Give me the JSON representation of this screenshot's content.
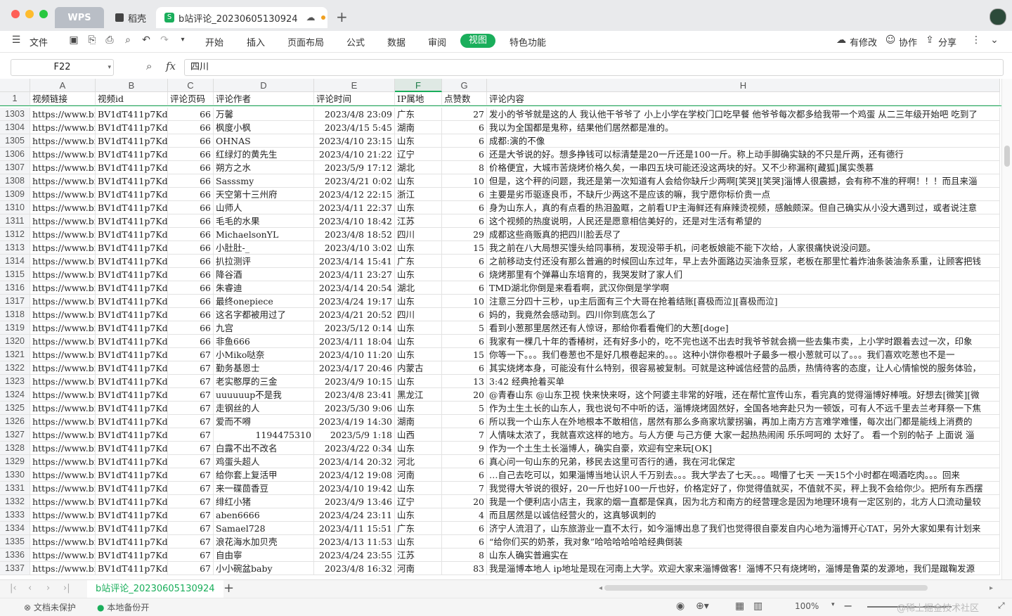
{
  "titlebar": {
    "tabs": [
      {
        "label": "WPS"
      },
      {
        "label": "稻壳"
      },
      {
        "label": "b站评论_20230605130924"
      }
    ],
    "new_tab": "+"
  },
  "toolbar": {
    "file_menu": "文件",
    "menu_items": [
      "开始",
      "插入",
      "页面布局",
      "公式",
      "数据",
      "审阅",
      "视图",
      "特色功能"
    ],
    "active_menu": "视图",
    "right_actions": [
      "有修改",
      "协作",
      "分享"
    ]
  },
  "formula_bar": {
    "cell_ref": "F22",
    "fx_label": "fx",
    "value": "四川"
  },
  "sheet": {
    "columns": [
      "A",
      "B",
      "C",
      "D",
      "E",
      "F",
      "G",
      "H"
    ],
    "selected_column": "F",
    "header_row_num": "1",
    "headers": [
      "视频链接",
      "视频id",
      "评论页码",
      "评论作者",
      "评论时间",
      "IP属地",
      "点赞数",
      "评论内容"
    ],
    "rows": [
      [
        "1303",
        "https://www.bili",
        "BV1dT411p7Kd",
        "66",
        "万馨",
        "2023/4/8 23:09",
        "广东",
        "27",
        "发小的爷爷就是这的人 我认他干爷爷了 小上小学在学校门口吃早餐 他爷爷每次都多给我带一个鸡蛋 从二三年级开始吧 吃到了"
      ],
      [
        "1304",
        "https://www.bili",
        "BV1dT411p7Kd",
        "66",
        "枫度小枫",
        "2023/4/15 5:45",
        "湖南",
        "6",
        "我以为全国都是鬼称，结果他们居然都是准的。"
      ],
      [
        "1305",
        "https://www.bili",
        "BV1dT411p7Kd",
        "66",
        "OHNAS",
        "2023/4/10 23:15",
        "山东",
        "6",
        "成都:演的不像"
      ],
      [
        "1306",
        "https://www.bili",
        "BV1dT411p7Kd",
        "66",
        "红绿灯的黄先生",
        "2023/4/10 21:22",
        "辽宁",
        "6",
        "还是大爷说的好。想多挣钱可以标清楚是20一斤还是100一斤。称上动手脚确实缺的不只是斤两，还有德行"
      ],
      [
        "1307",
        "https://www.bili",
        "BV1dT411p7Kd",
        "66",
        "朔方之水",
        "2023/5/9 17:12",
        "湖北",
        "8",
        "价格便宜，大城市苦烧烤价格久矣，一串四五块可能还没这两块的好。又不少称漏称[藏狐]属实羡慕"
      ],
      [
        "1308",
        "https://www.bili",
        "BV1dT411p7Kd",
        "66",
        "Sasssmy",
        "2023/4/21 0:02",
        "山东",
        "10",
        "但是，这个秤的问题，我还是第一次知道有人会给你缺斤少两啊[笑哭][笑哭]淄博人很震撼，会有称不准的秤啊！！！而且来淄"
      ],
      [
        "1309",
        "https://www.bili",
        "BV1dT411p7Kd",
        "66",
        "天空第十三州府",
        "2023/4/12 22:15",
        "浙江",
        "6",
        "主要是劣币驱逐良币，不缺斤少两这不是应该的嘛，我宁愿你标价贵一点"
      ],
      [
        "1310",
        "https://www.bili",
        "BV1dT411p7Kd",
        "66",
        "山师人",
        "2023/4/11 22:37",
        "山东",
        "6",
        "身为山东人，真的有点看的热泪盈眶，之前看UP主海鲜还有麻辣烫视频，感触颇深。但自己确实从小没大遇到过，或者说注意"
      ],
      [
        "1311",
        "https://www.bili",
        "BV1dT411p7Kd",
        "66",
        "毛毛的水果",
        "2023/4/10 18:42",
        "江苏",
        "6",
        "这个视频的热度说明，人民还是愿意相信美好的，还是对生活有希望的"
      ],
      [
        "1312",
        "https://www.bili",
        "BV1dT411p7Kd",
        "66",
        "MichaelsonYL",
        "2023/4/8 18:52",
        "四川",
        "29",
        "成都这些商贩真的把四川脸丢尽了"
      ],
      [
        "1313",
        "https://www.bili",
        "BV1dT411p7Kd",
        "66",
        "小肚肚-_",
        "2023/4/10 3:02",
        "山东",
        "15",
        "我之前在八大局想买馒头给同事稍，发现没带手机，问老板娘能不能下次给，人家很痛快说没问题。"
      ],
      [
        "1314",
        "https://www.bili",
        "BV1dT411p7Kd",
        "66",
        "扒拉测评",
        "2023/4/14 15:41",
        "广东",
        "6",
        "之前移动支付还没有那么普遍的时候回山东过年，早上去外面路边买油条豆浆，老板在那里忙着炸油条装油条系重，让顾客把钱"
      ],
      [
        "1315",
        "https://www.bili",
        "BV1dT411p7Kd",
        "66",
        "降谷酒",
        "2023/4/11 23:27",
        "山东",
        "6",
        "烧烤那里有个弹幕山东培育的，我哭发财了家人们"
      ],
      [
        "1316",
        "https://www.bili",
        "BV1dT411p7Kd",
        "66",
        "朱睿迪",
        "2023/4/14 20:54",
        "湖北",
        "6",
        "TMD湖北你倒是来看看啊，武汉你倒是学学啊"
      ],
      [
        "1317",
        "https://www.bili",
        "BV1dT411p7Kd",
        "66",
        "最终onepiece",
        "2023/4/24 19:17",
        "山东",
        "10",
        "注意三分四十三秒，up主后面有三个大哥在抢着结账[喜极而泣][喜极而泣]"
      ],
      [
        "1318",
        "https://www.bili",
        "BV1dT411p7Kd",
        "66",
        "这名字都被用过了",
        "2023/4/21 20:52",
        "四川",
        "6",
        "妈的，我竟然会感动到。四川你到底怎么了"
      ],
      [
        "1319",
        "https://www.bili",
        "BV1dT411p7Kd",
        "66",
        "九宫",
        "2023/5/12 0:14",
        "山东",
        "5",
        "看到小葱那里居然还有人惊讶，那给你看看俺们的大葱[doge]"
      ],
      [
        "1320",
        "https://www.bili",
        "BV1dT411p7Kd",
        "66",
        "非鱼666",
        "2023/4/11 18:04",
        "山东",
        "6",
        "我家有一棵几十年的香椿树，还有好多小的，吃不完也送不出去时我爷爷就会摘一些去集市卖，上小学时跟着去过一次，印象"
      ],
      [
        "1321",
        "https://www.bili",
        "BV1dT411p7Kd",
        "67",
        "小Miko哒奈",
        "2023/4/10 11:20",
        "山东",
        "15",
        "你等一下。。。我们卷葱也不是好几根卷起来的。。。这种小饼你卷根叶子最多一根小葱就可以了。。。我们喜欢吃葱也不是一"
      ],
      [
        "1322",
        "https://www.bili",
        "BV1dT411p7Kd",
        "67",
        "勤务基恩士",
        "2023/4/17 20:46",
        "内蒙古",
        "6",
        "其实烧烤本身，可能没有什么特别，很容易被复制。可就是这种诚信经营的品质，热情待客的态度，让人心情愉悦的服务体验，"
      ],
      [
        "1323",
        "https://www.bili",
        "BV1dT411p7Kd",
        "67",
        "老实憨厚的三金",
        "2023/4/9 10:15",
        "山东",
        "13",
        "3:42 经典抢着买单"
      ],
      [
        "1324",
        "https://www.bili",
        "BV1dT411p7Kd",
        "67",
        "uuuuuup不是我",
        "2023/4/8 23:41",
        "黑龙江",
        "20",
        "@青春山东 @山东卫视 快来快来呀，这个阿婆主非常的好哦，还在帮忙宣传山东，看完真的觉得淄博好棒哦。好想去[微笑][微"
      ],
      [
        "1325",
        "https://www.bili",
        "BV1dT411p7Kd",
        "67",
        "走钢丝的人",
        "2023/5/30 9:06",
        "山东",
        "5",
        "作为土生土长的山东人，我也说句不中听的话，淄博烧烤固然好，全国各地奔赴只为一顿饭，可有人不远千里去兰考拜祭一下焦"
      ],
      [
        "1326",
        "https://www.bili",
        "BV1dT411p7Kd",
        "67",
        "爱而不嘚",
        "2023/4/19 14:30",
        "湖南",
        "6",
        "所以我一个山东人在外地根本不敢相信，居然有那么多商家坑蒙拐骗，再加上南方方言难学难懂，每次出门都是能线上消费的"
      ],
      [
        "1327",
        "https://www.bili",
        "BV1dT411p7Kd",
        "67",
        "1194475310",
        "2023/5/9 1:18",
        "山西",
        "7",
        "人情味太浓了，我就喜欢这样的地方。与人方便 与己方便 大家一起热热闹闹 乐乐呵呵的 太好了。 看一个别的帖子 上面说 淄"
      ],
      [
        "1328",
        "https://www.bili",
        "BV1dT411p7Kd",
        "67",
        "白露不出不改名",
        "2023/4/22 0:34",
        "山东",
        "9",
        "作为一个土生土长淄博人，确实自豪，欢迎有空来玩[OK]"
      ],
      [
        "1329",
        "https://www.bili",
        "BV1dT411p7Kd",
        "67",
        "鸡蛋头超人",
        "2023/4/14 20:32",
        "河北",
        "6",
        "真心问一句山东的兄弟，移民去这里可否行的通，我在河北保定"
      ],
      [
        "1330",
        "https://www.bili",
        "BV1dT411p7Kd",
        "67",
        "给你套上复活甲",
        "2023/4/12 19:08",
        "河南",
        "6",
        "…自己去吃可以，如果淄博当地认识人千万别去。。。我大学去了七天。。。喝懵了七天 一天15个小时都在喝酒吃肉。。。回来"
      ],
      [
        "1331",
        "https://www.bili",
        "BV1dT411p7Kd",
        "67",
        "来一碟茴香豆",
        "2023/4/10 19:42",
        "山东",
        "7",
        "我觉得大爷说的很好，20一斤也好100一斤也好，价格定好了，你觉得值就买，不值就不买，秤上我不会给你少。把所有东西摆"
      ],
      [
        "1332",
        "https://www.bili",
        "BV1dT411p7Kd",
        "67",
        "绯红小猪",
        "2023/4/9 13:46",
        "辽宁",
        "20",
        "我是一个便利店小店主，我家的烟一直都是保真，因为北方和南方的经营理念是因为地理环境有一定区别的，北方人口流动量较"
      ],
      [
        "1333",
        "https://www.bili",
        "BV1dT411p7Kd",
        "67",
        "aben6666",
        "2023/4/24 23:11",
        "山东",
        "4",
        "而且居然是以诚信经营火的，这真够讽刺的"
      ],
      [
        "1334",
        "https://www.bili",
        "BV1dT411p7Kd",
        "67",
        "Samael728",
        "2023/4/11 15:51",
        "广东",
        "6",
        "济宁人流泪了，山东旅游业一直不太行，如今淄博出息了我们也觉得很自豪发自内心地为淄博开心TAT，另外大家如果有计划来"
      ],
      [
        "1335",
        "https://www.bili",
        "BV1dT411p7Kd",
        "67",
        "浪花海水加贝壳",
        "2023/4/13 11:53",
        "山东",
        "6",
        "“给你们买的奶茶，我对象”哈哈哈哈哈哈经典倒装"
      ],
      [
        "1336",
        "https://www.bili",
        "BV1dT411p7Kd",
        "67",
        "自由寧",
        "2023/4/24 23:55",
        "江苏",
        "8",
        "山东人确实普遍实在"
      ],
      [
        "1337",
        "https://www.bili",
        "BV1dT411p7Kd",
        "67",
        "小小碗盆baby",
        "2023/4/8 16:32",
        "河南",
        "83",
        "我是淄博本地人 ip地址是现在河南上大学。欢迎大家来淄博做客！淄博不只有烧烤哟，淄博是鲁菜的发源地，我们是蹴鞠发源"
      ]
    ]
  },
  "sheet_tabs": {
    "active": "b站评论_20230605130924",
    "add": "+"
  },
  "statusbar": {
    "protect": "文档未保护",
    "backup": "本地备份开",
    "zoom": "100%",
    "watermark": "@稀土掘金技术社区"
  },
  "colors": {
    "accent": "#1aae5b",
    "titlebar_bg": "#e9eaec",
    "selected_header_bg": "#dfe9e4"
  }
}
